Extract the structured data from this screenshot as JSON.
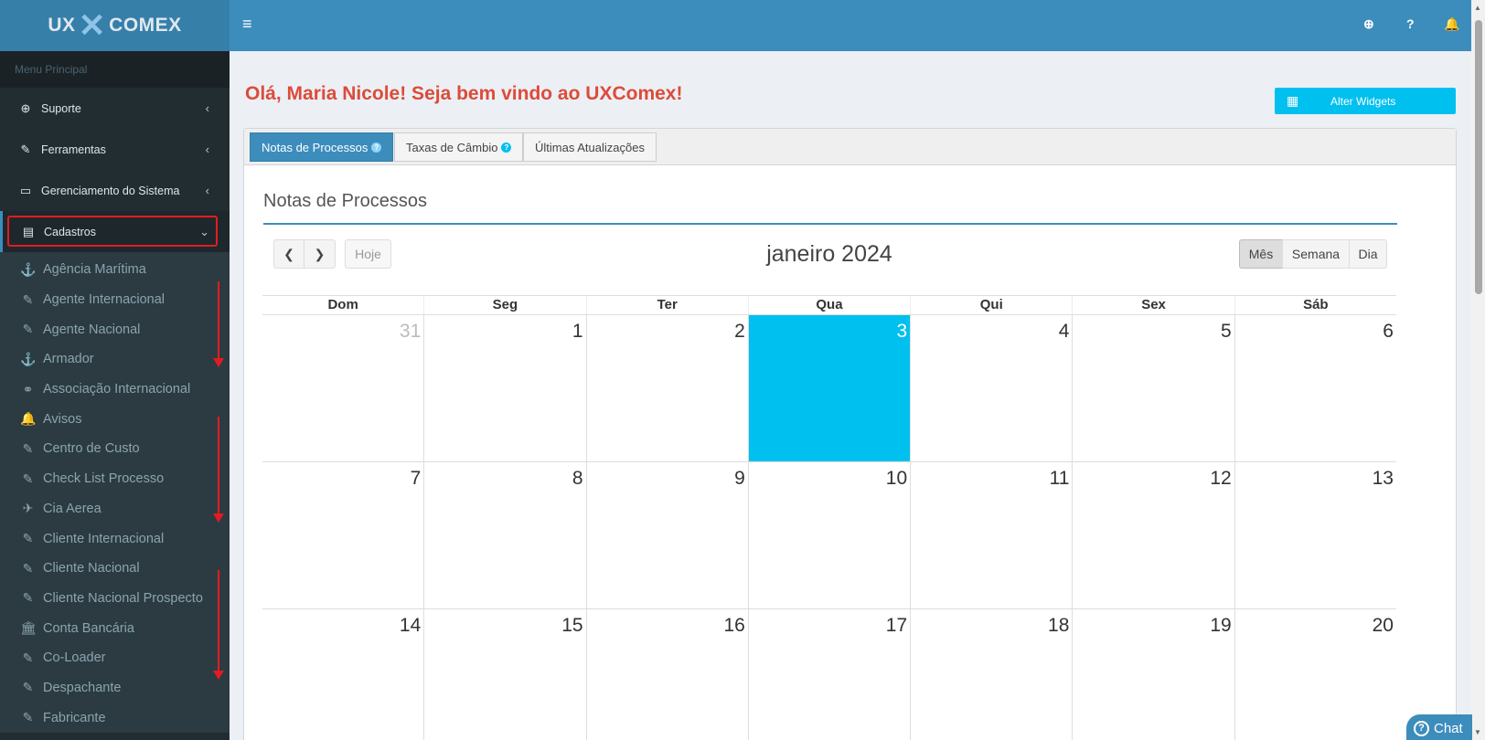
{
  "app": {
    "logo_left": "UX",
    "logo_x": "✕",
    "logo_right": "COMEX"
  },
  "sidebar": {
    "header": "Menu Principal",
    "items": [
      {
        "label": "Suporte",
        "icon": "support-icon",
        "glyph": "⊕"
      },
      {
        "label": "Ferramentas",
        "icon": "wrench-icon",
        "glyph": "✎"
      },
      {
        "label": "Gerenciamento do Sistema",
        "icon": "laptop-icon",
        "glyph": "▭"
      },
      {
        "label": "Cadastros",
        "icon": "book-icon",
        "glyph": "▤"
      }
    ],
    "subitems": [
      {
        "label": "Agência Marítima",
        "glyph": "⚓"
      },
      {
        "label": "Agente Internacional",
        "glyph": "✎"
      },
      {
        "label": "Agente Nacional",
        "glyph": "✎"
      },
      {
        "label": "Armador",
        "glyph": "⚓"
      },
      {
        "label": "Associação Internacional",
        "glyph": "⚭"
      },
      {
        "label": "Avisos",
        "glyph": "🔔"
      },
      {
        "label": "Centro de Custo",
        "glyph": "✎"
      },
      {
        "label": "Check List Processo",
        "glyph": "✎"
      },
      {
        "label": "Cia Aerea",
        "glyph": "✈"
      },
      {
        "label": "Cliente Internacional",
        "glyph": "✎"
      },
      {
        "label": "Cliente Nacional",
        "glyph": "✎"
      },
      {
        "label": "Cliente Nacional Prospecto",
        "glyph": "✎"
      },
      {
        "label": "Conta Bancária",
        "glyph": "🏛"
      },
      {
        "label": "Co-Loader",
        "glyph": "✎"
      },
      {
        "label": "Despachante",
        "glyph": "✎"
      },
      {
        "label": "Fabricante",
        "glyph": "✎"
      }
    ]
  },
  "topbar": {
    "menu_glyph": "≡",
    "support_glyph": "⊕",
    "help_glyph": "?",
    "bell_glyph": "🔔"
  },
  "main": {
    "greeting": "Olá, Maria Nicole! Seja bem vindo ao UXComex!",
    "widgets_button": "Alter Widgets",
    "widgets_glyph": "▦",
    "tabs": [
      {
        "label": "Notas de Processos"
      },
      {
        "label": "Taxas de Câmbio"
      },
      {
        "label": "Últimas Atualizações"
      }
    ],
    "tab_help_glyph": "?",
    "section_title": "Notas de Processos"
  },
  "calendar": {
    "title": "janeiro 2024",
    "prev_glyph": "❮",
    "next_glyph": "❯",
    "today_label": "Hoje",
    "views": [
      "Mês",
      "Semana",
      "Dia"
    ],
    "selected_view": "Mês",
    "weekdays": [
      "Dom",
      "Seg",
      "Ter",
      "Qua",
      "Qui",
      "Sex",
      "Sáb"
    ],
    "weeks": [
      [
        "31",
        "1",
        "2",
        "3",
        "4",
        "5",
        "6"
      ],
      [
        "7",
        "8",
        "9",
        "10",
        "11",
        "12",
        "13"
      ],
      [
        "14",
        "15",
        "16",
        "17",
        "18",
        "19",
        "20"
      ]
    ],
    "today": "3",
    "today_color": "#00c0ef"
  },
  "chat": {
    "label": "Chat",
    "glyph": "?"
  },
  "colors": {
    "accent": "#3c8dbc",
    "greeting": "#dd4b39",
    "sidebar": "#222d32",
    "highlight": "#e31b23"
  }
}
